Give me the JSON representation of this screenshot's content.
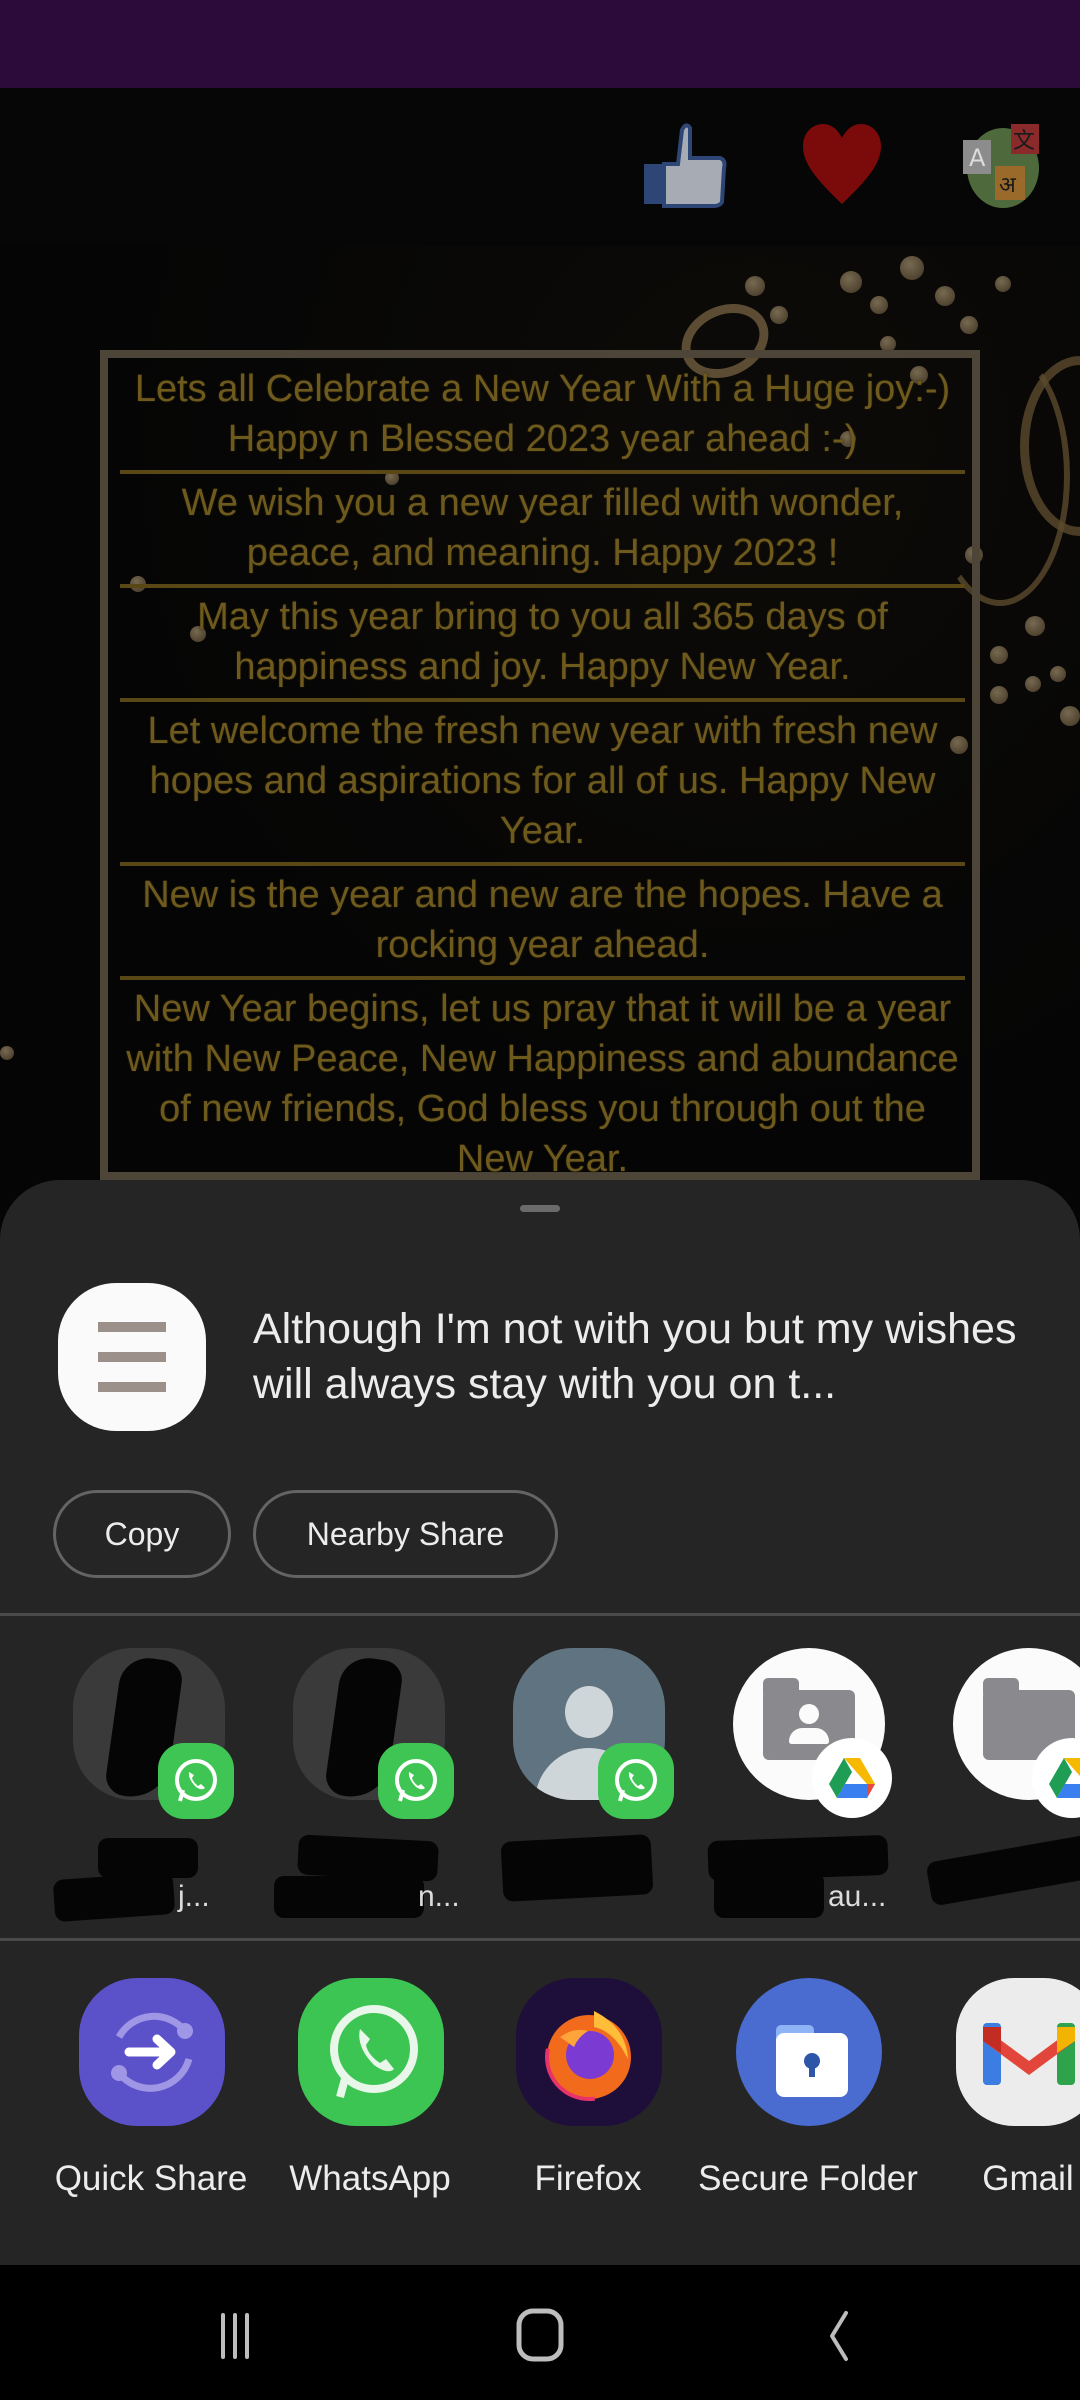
{
  "background_app": {
    "status_bar_color": "#2c0a3a",
    "toolbar_icons": [
      {
        "name": "like",
        "icon": "thumbs-up-icon"
      },
      {
        "name": "favorite",
        "icon": "heart-icon"
      },
      {
        "name": "translate",
        "icon": "translate-icon",
        "glyphs": [
          "A",
          "文",
          "अ"
        ]
      }
    ],
    "wishes": [
      "Lets all Celebrate a New Year With a Huge joy:-) Happy n Blessed 2023 year ahead :-)",
      "We wish you a new year filled with wonder, peace, and meaning. Happy 2023 !",
      "May this year bring to you all 365 days of happiness and joy. Happy New Year.",
      "Let welcome the fresh new year with fresh new hopes and aspirations for all of us. Happy New Year.",
      "New is the year and new are the hopes. Have a rocking year ahead.",
      "New Year begins, let us pray that it will be a year with New Peace, New Happiness and abundance of new friends, God bless you through out the New Year."
    ],
    "accent_color": "#6f5a1e"
  },
  "share_sheet": {
    "preview": {
      "icon": "text-document-icon",
      "text": "Although I'm not with you but my wishes will always stay with you on t..."
    },
    "actions": {
      "copy_label": "Copy",
      "nearby_share_label": "Nearby Share"
    },
    "direct_targets": [
      {
        "avatar": "redacted-photo",
        "app_badge": "whatsapp",
        "name_visible_tail": "j...",
        "redacted": true
      },
      {
        "avatar": "redacted-photo",
        "app_badge": "whatsapp",
        "name_visible_tail": "n...",
        "redacted": true
      },
      {
        "avatar": "default-contact",
        "app_badge": "whatsapp",
        "name_visible_tail": "",
        "redacted": true
      },
      {
        "avatar": "shared-folder",
        "app_badge": "google-drive",
        "name_visible_tail": "au...",
        "redacted": true
      },
      {
        "avatar": "folder",
        "app_badge": "google-drive",
        "name_visible_tail": "",
        "redacted": true
      }
    ],
    "apps": [
      {
        "label": "Quick Share",
        "icon": "quick-share-icon",
        "color": "#5b51c9"
      },
      {
        "label": "WhatsApp",
        "icon": "whatsapp-icon",
        "color": "#3dc553"
      },
      {
        "label": "Firefox",
        "icon": "firefox-icon",
        "color": "#1e0f3a"
      },
      {
        "label": "Secure Folder",
        "icon": "secure-folder-icon",
        "color": "#4a6bd0"
      },
      {
        "label": "Gmail",
        "icon": "gmail-icon",
        "color": "#ececec"
      }
    ]
  },
  "nav_bar": {
    "buttons": [
      "recents",
      "home",
      "back"
    ]
  }
}
